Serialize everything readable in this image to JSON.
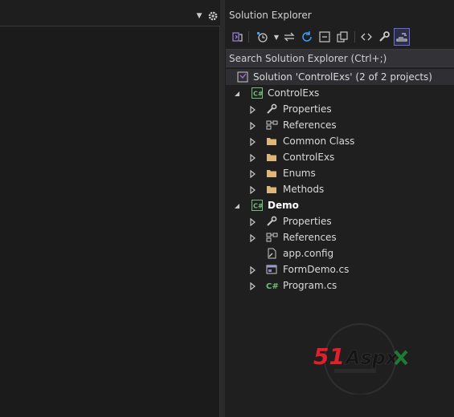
{
  "solution_explorer": {
    "title": "Solution Explorer",
    "search_placeholder": "Search Solution Explorer (Ctrl+;)",
    "solution_label": "Solution 'ControlExs' (2 of 2 projects)",
    "projects": [
      {
        "name": "ControlExs",
        "items": [
          "Properties",
          "References",
          "Common Class",
          "ControlExs",
          "Enums",
          "Methods"
        ]
      },
      {
        "name": "Demo",
        "items": [
          "Properties",
          "References",
          "app.config",
          "FormDemo.cs",
          "Program.cs"
        ]
      }
    ]
  },
  "watermark": {
    "brand_red": "51",
    "brand_dark": "Aspx"
  },
  "icons": {
    "project": "csharp-project-icon",
    "properties": "wrench-icon",
    "references": "references-icon",
    "folder": "folder-icon",
    "config": "config-file-icon",
    "form": "form-icon",
    "cs_file": "csharp-file-icon"
  },
  "colors": {
    "background": "#1e1e1e",
    "panel": "#1f1f1f",
    "folder": "#dcb67a",
    "csharp_green": "#6fbf73",
    "selection": "#2f2f33",
    "watermark_red": "#e0202a"
  }
}
